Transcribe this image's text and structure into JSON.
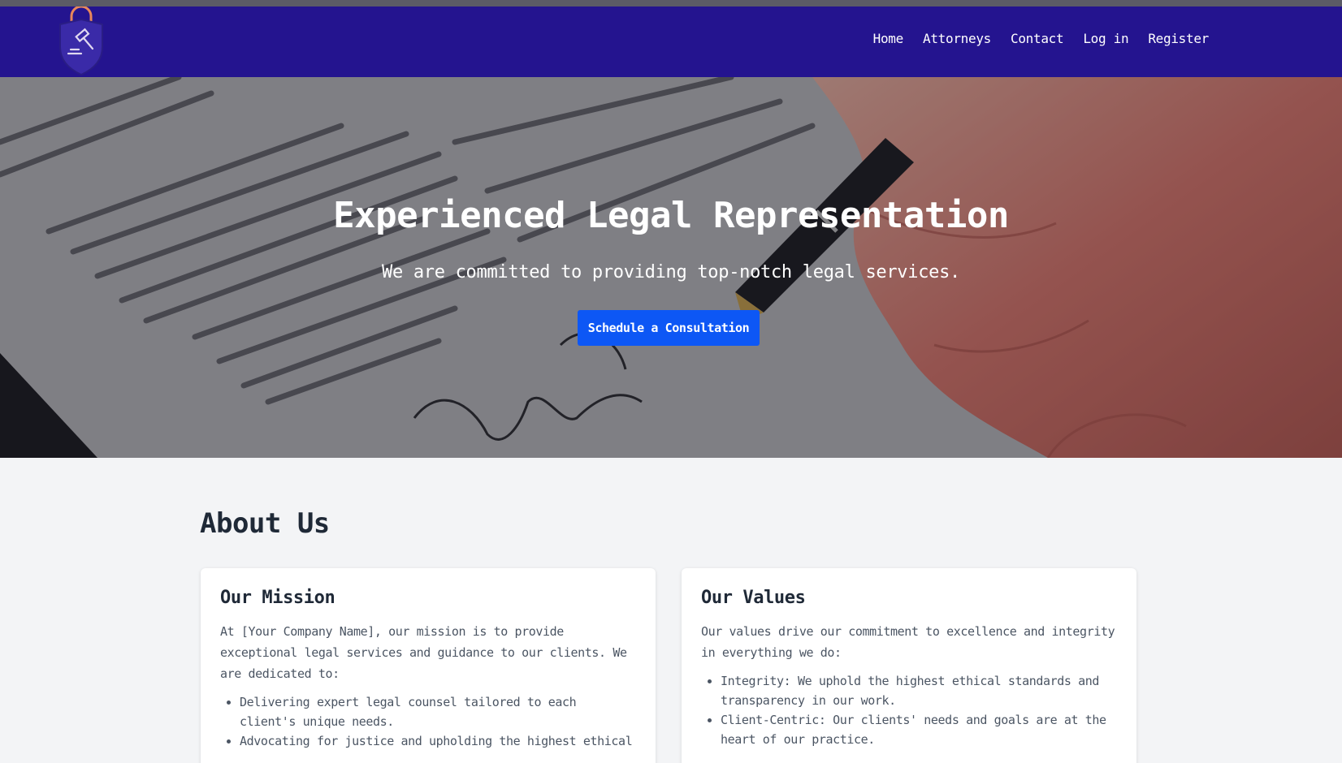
{
  "navbar": {
    "links": [
      "Home",
      "Attorneys",
      "Contact",
      "Log in",
      "Register"
    ]
  },
  "hero": {
    "title": "Experienced Legal Representation",
    "subtitle": "We are committed to providing top-notch legal services.",
    "cta_label": "Schedule a Consultation"
  },
  "about": {
    "title": "About Us",
    "mission": {
      "title": "Our Mission",
      "text": "At [Your Company Name], our mission is to provide exceptional legal services and guidance to our clients. We are dedicated to:",
      "items": [
        "Delivering expert legal counsel tailored to each client's unique needs.",
        "Advocating for justice and upholding the highest ethical"
      ]
    },
    "values": {
      "title": "Our Values",
      "text": "Our values drive our commitment to excellence and integrity in everything we do:",
      "items": [
        "Integrity: We uphold the highest ethical standards and transparency in our work.",
        "Client-Centric: Our clients' needs and goals are at the heart of our practice."
      ]
    }
  },
  "colors": {
    "navbar": "#24148f",
    "cta": "#0d57f5",
    "logo_accent": "#e8875a",
    "logo_shield": "#3a2aa8",
    "page_bg": "#f3f4f6"
  },
  "icons": {
    "logo": "gavel-shield-icon"
  }
}
